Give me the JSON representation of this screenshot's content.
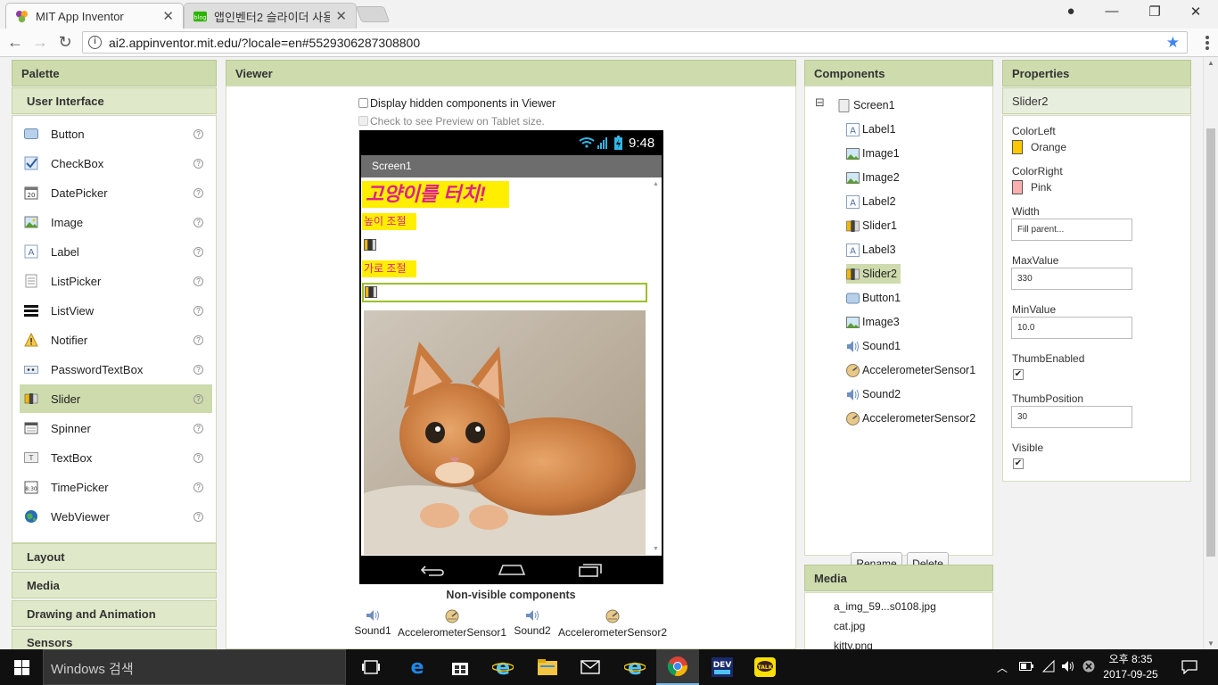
{
  "browser": {
    "tabs": [
      {
        "title": "MIT App Inventor",
        "active": true
      },
      {
        "title": "앱인벤터2 슬라이더 사용",
        "active": false
      }
    ],
    "url": "ai2.appinventor.mit.edu/?locale=en#5529306287308800"
  },
  "palette": {
    "title": "Palette",
    "section": "User Interface",
    "items": [
      "Button",
      "CheckBox",
      "DatePicker",
      "Image",
      "Label",
      "ListPicker",
      "ListView",
      "Notifier",
      "PasswordTextBox",
      "Slider",
      "Spinner",
      "TextBox",
      "TimePicker",
      "WebViewer"
    ],
    "selected": "Slider",
    "help_glyph": "?",
    "other_sections": [
      "Layout",
      "Media",
      "Drawing and Animation",
      "Sensors"
    ]
  },
  "viewer": {
    "title": "Viewer",
    "hidden_label": "Display hidden components in Viewer",
    "tablet_label": "Check to see Preview on Tablet size.",
    "phone_time": "9:48",
    "screen_title": "Screen1",
    "label1": "고양이를 터치!",
    "label2": "높이 조절",
    "label3": "가로 조절",
    "nonvisible_title": "Non-visible components",
    "nonvisible": [
      "Sound1",
      "AccelerometerSensor1",
      "Sound2",
      "AccelerometerSensor2"
    ]
  },
  "components": {
    "title": "Components",
    "collapse_glyph": "⊟",
    "root": "Screen1",
    "items": [
      "Label1",
      "Image1",
      "Image2",
      "Label2",
      "Slider1",
      "Label3",
      "Slider2",
      "Button1",
      "Image3",
      "Sound1",
      "AccelerometerSensor1",
      "Sound2",
      "AccelerometerSensor2"
    ],
    "selected": "Slider2",
    "rename": "Rename",
    "delete": "Delete"
  },
  "media": {
    "title": "Media",
    "files": [
      "a_img_59...s0108.jpg",
      "cat.jpg",
      "kitty.png"
    ]
  },
  "properties": {
    "title": "Properties",
    "component": "Slider2",
    "color_left_label": "ColorLeft",
    "color_left": "Orange",
    "color_left_hex": "#ffc800",
    "color_right_label": "ColorRight",
    "color_right": "Pink",
    "color_right_hex": "#ffafaf",
    "width_label": "Width",
    "width": "Fill parent...",
    "max_label": "MaxValue",
    "max": "330",
    "min_label": "MinValue",
    "min": "10.0",
    "thumb_enabled_label": "ThumbEnabled",
    "thumb_enabled": true,
    "thumb_pos_label": "ThumbPosition",
    "thumb_pos": "30",
    "visible_label": "Visible",
    "visible": true,
    "checkmark": "✔"
  },
  "taskbar": {
    "search": "Windows 검색",
    "time": "오후 8:35",
    "date": "2017-09-25",
    "dev_badge": "DEV",
    "talk_badge": "TALK"
  },
  "chrome_glyphs": {
    "close": "✕",
    "minimize": "—",
    "maximize": "❐",
    "back": "←",
    "forward": "→",
    "reload": "↻",
    "info": "i",
    "star": "★",
    "profile": "●"
  }
}
